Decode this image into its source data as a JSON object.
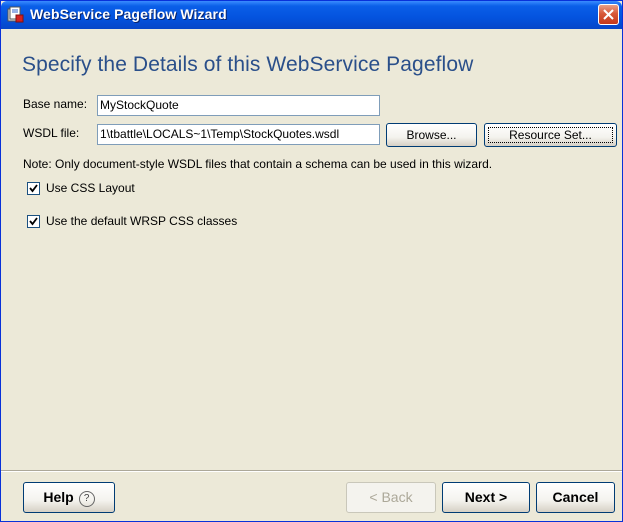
{
  "window": {
    "title": "WebService Pageflow Wizard",
    "icon": "wizard-app-icon",
    "close_icon": "close-icon"
  },
  "main": {
    "heading": "Specify the Details of this WebService Pageflow",
    "base_name": {
      "label": "Base name:",
      "value": "MyStockQuote"
    },
    "wsdl_file": {
      "label": "WSDL file:",
      "value": "1\\tbattle\\LOCALS~1\\Temp\\StockQuotes.wsdl"
    },
    "browse_label": "Browse...",
    "resource_set_label": "Resource Set...",
    "note": "Note: Only document-style WSDL files that contain a schema can be used in this wizard.",
    "options": [
      {
        "label": "Use CSS Layout",
        "checked": true
      },
      {
        "label": "Use the default WRSP CSS classes",
        "checked": true
      }
    ]
  },
  "footer": {
    "help_label": "Help",
    "back_label": "< Back",
    "next_label": "Next >",
    "cancel_label": "Cancel"
  },
  "colors": {
    "titlebar": "#0453DE",
    "heading": "#2A4F8A",
    "dialog_bg": "#ECE9D8",
    "close": "#D8593A"
  }
}
